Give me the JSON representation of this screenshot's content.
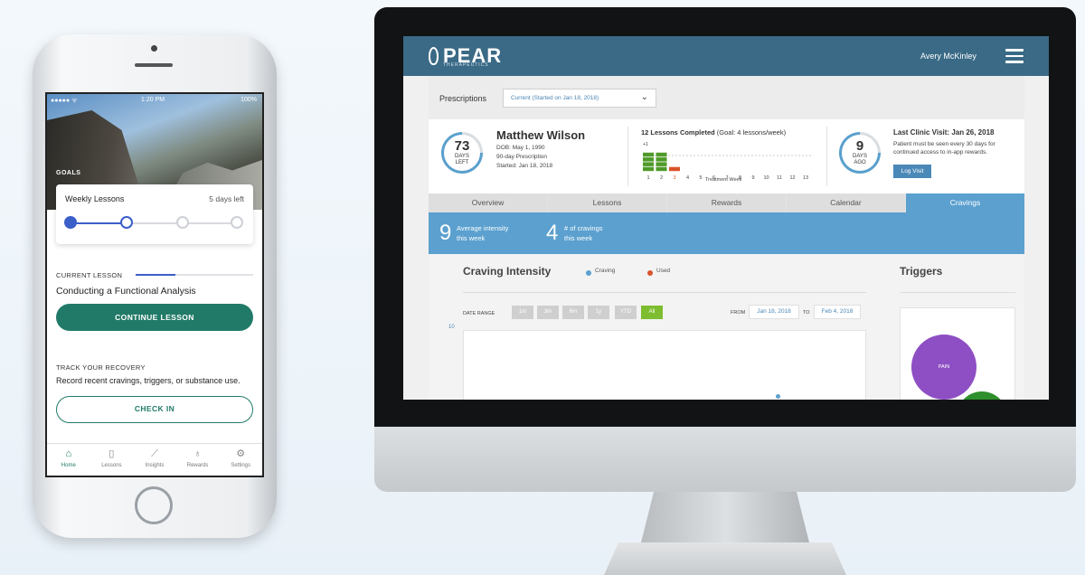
{
  "colors": {
    "brand_teal": "#217a68",
    "accent_blue": "#3b5fc9",
    "header_blue": "#3a6a86",
    "panel_blue": "#5ba0cf",
    "green": "#7dbd2f",
    "purple": "#8e4fc4"
  },
  "mobile": {
    "status": {
      "carrier": "●●●●● ᯤ",
      "time": "1:20 PM",
      "battery": "100%"
    },
    "goals_label": "GOALS",
    "goal_card": {
      "title": "Weekly Lessons",
      "days_left": "5 days left",
      "progress": {
        "completed": 1,
        "current": 2,
        "total": 4
      }
    },
    "current_lesson": {
      "label": "CURRENT LESSON",
      "title": "Conducting a Functional Analysis",
      "progress_pct": 34,
      "button": "CONTINUE LESSON"
    },
    "track": {
      "label": "TRACK YOUR RECOVERY",
      "desc": "Record recent cravings, triggers, or substance use.",
      "button": "CHECK IN"
    },
    "tabs": [
      {
        "label": "Home",
        "icon": "home-icon"
      },
      {
        "label": "Lessons",
        "icon": "book-icon"
      },
      {
        "label": "Insights",
        "icon": "chart-icon"
      },
      {
        "label": "Rewards",
        "icon": "award-icon"
      },
      {
        "label": "Settings",
        "icon": "gear-icon"
      }
    ]
  },
  "desktop": {
    "logo": "PEAR",
    "logo_sub": "THERAPEUTICS",
    "user": "Avery McKinley",
    "prescriptions_label": "Prescriptions",
    "prescription_value": "Current (Started on Jan 18, 2018)",
    "patient": {
      "days_left": "73",
      "days_left_label1": "DAYS",
      "days_left_label2": "LEFT",
      "name": "Matthew Wilson",
      "dob": "DOB: May 1, 1990",
      "rx": "90-day Prescription",
      "started": "Started: Jan 18, 2018"
    },
    "lessons": {
      "title_bold": "12 Lessons Completed",
      "title_rest": " (Goal: 4 lessons/week)",
      "x_ticks": [
        "1",
        "2",
        "3",
        "4",
        "5",
        "6",
        "7",
        "8",
        "9",
        "10",
        "11",
        "12",
        "13"
      ],
      "x_label": "Treatment Week",
      "over_label": "+1",
      "values": [
        4,
        4,
        1,
        0,
        0,
        0,
        0,
        0,
        0,
        0,
        0,
        0,
        0
      ]
    },
    "visit": {
      "days": "9",
      "days_label1": "DAYS",
      "days_label2": "AGO",
      "title": "Last Clinic Visit: Jan 26, 2018",
      "desc": "Patient must be seen every 30 days for continued access to in-app rewards.",
      "button": "Log Visit"
    },
    "tabs": [
      "Overview",
      "Lessons",
      "Rewards",
      "Calendar",
      "Cravings"
    ],
    "stats": [
      {
        "value": "9",
        "label1": "Average intensity",
        "label2": "this week"
      },
      {
        "value": "4",
        "label1": "# of cravings",
        "label2": "this week"
      }
    ],
    "craving": {
      "title": "Craving Intensity",
      "legend": [
        {
          "label": "Craving",
          "color": "#5ba0cf"
        },
        {
          "label": "Used",
          "color": "#d9532b"
        }
      ],
      "date_range_label": "DATE RANGE",
      "ranges": [
        "1m",
        "3m",
        "6m",
        "1y",
        "YTD",
        "All"
      ],
      "active_range": "All",
      "from_label": "FROM",
      "from": "Jan 18, 2018",
      "to_label": "TO",
      "to": "Feb 4, 2018",
      "y_tick": "10"
    },
    "triggers": {
      "title": "Triggers",
      "bubbles": [
        "PAIN"
      ]
    }
  }
}
